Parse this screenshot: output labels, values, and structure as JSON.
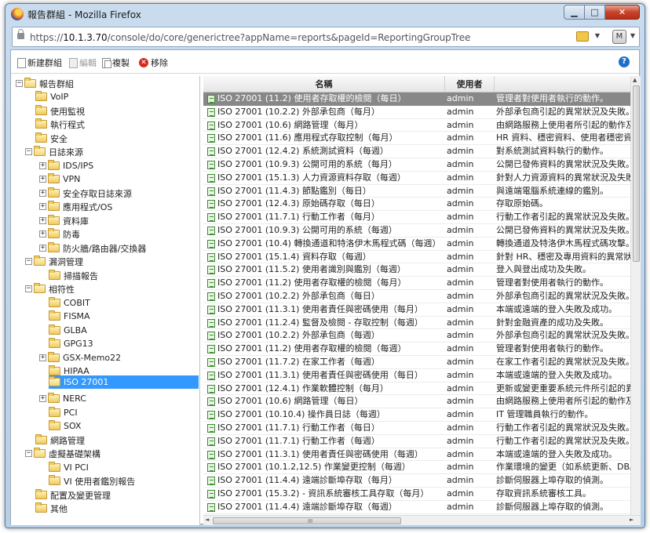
{
  "window": {
    "title": "報告群組 - Mozilla Firefox",
    "min_label": "▁",
    "max_label": "□",
    "close_label": "✕"
  },
  "address": {
    "url_prefix": "https://",
    "url_host": "10.1.3.70",
    "url_path": "/console/do/core/generictree?appName=reports&pageId=ReportingGroupTree"
  },
  "toolbar": {
    "new_label": "新建群組",
    "edit_label": "編輯",
    "copy_label": "複製",
    "remove_label": "移除",
    "help_label": "?"
  },
  "tree": {
    "root": "報告群組",
    "voip": "VoIP",
    "usage": "使用監視",
    "exec": "執行程式",
    "security": "安全",
    "logsrc": "日誌來源",
    "ids": "IDS/IPS",
    "vpn": "VPN",
    "seclog": "安全存取日誌來源",
    "app": "應用程式/OS",
    "db": "資料庫",
    "av": "防毒",
    "fw": "防火牆/路由器/交換器",
    "vuln": "漏洞管理",
    "scan": "掃描報告",
    "compliance": "相符性",
    "cobit": "COBIT",
    "fisma": "FISMA",
    "glba": "GLBA",
    "gpg13": "GPG13",
    "gsx": "GSX-Memo22",
    "hipaa": "HIPAA",
    "iso": "ISO 27001",
    "nerc": "NERC",
    "pci": "PCI",
    "sox": "SOX",
    "netmgmt": "網路管理",
    "virt": "虛擬基礎架構",
    "vipci": "VI PCI",
    "viuser": "VI 使用者鑑別報告",
    "config": "配置及變更管理",
    "other": "其他"
  },
  "grid": {
    "headers": {
      "name": "名稱",
      "owner": "使用者",
      "desc": ""
    },
    "scroll_grip": "III",
    "rows": [
      {
        "name": "ISO 27001 (11.2) 使用者存取權的檢閱（每日）",
        "owner": "admin",
        "desc": "管理者對使用者執行的動作。"
      },
      {
        "name": "ISO 27001 (10.2.2) 外部承包商（每月）",
        "owner": "admin",
        "desc": "外部承包商引起的異常狀況及失敗。"
      },
      {
        "name": "ISO 27001 (10.6) 網路管理（每月）",
        "owner": "admin",
        "desc": "由網路服務上使用者所引起的動作及"
      },
      {
        "name": "ISO 27001 (11.6) 應用程式存取控制（每月）",
        "owner": "admin",
        "desc": "HR 資料、穩密資料、使用者穩密資"
      },
      {
        "name": "ISO 27001 (12.4.2) 系統測試資料（每週）",
        "owner": "admin",
        "desc": "對系統測試資料執行的動作。"
      },
      {
        "name": "ISO 27001 (10.9.3) 公開可用的系統（每月）",
        "owner": "admin",
        "desc": "公開已發佈資料的異常狀況及失敗。"
      },
      {
        "name": "ISO 27001 (15.1.3) 人力資源資料存取（每週）",
        "owner": "admin",
        "desc": "針對人力資源資料的異常狀況及失敗"
      },
      {
        "name": "ISO 27001 (11.4.3) 節點鑑別（每日）",
        "owner": "admin",
        "desc": "與遠端電腦系統連線的鑑別。"
      },
      {
        "name": "ISO 27001 (12.4.3) 原始碼存取（每日）",
        "owner": "admin",
        "desc": "存取原始碼。"
      },
      {
        "name": "ISO 27001 (11.7.1) 行動工作者（每月）",
        "owner": "admin",
        "desc": "行動工作者引起的異常狀況及失敗。"
      },
      {
        "name": "ISO 27001 (10.9.3) 公開可用的系統（每週）",
        "owner": "admin",
        "desc": "公開已發佈資料的異常狀況及失敗。"
      },
      {
        "name": "ISO 27001 (10.4) 轉換通道和特洛伊木馬程式碼（每週）",
        "owner": "admin",
        "desc": "轉換通道及特洛伊木馬程式碼攻擊。"
      },
      {
        "name": "ISO 27001 (15.1.4) 資料存取（每週）",
        "owner": "admin",
        "desc": "針對 HR、穩密及專用資料的異常狀況"
      },
      {
        "name": "ISO 27001 (11.5.2) 使用者識別與鑑別（每週）",
        "owner": "admin",
        "desc": "登入與登出成功及失敗。"
      },
      {
        "name": "ISO 27001 (11.2) 使用者存取權的檢閱（每月）",
        "owner": "admin",
        "desc": "管理者對使用者執行的動作。"
      },
      {
        "name": "ISO 27001 (10.2.2) 外部承包商（每日）",
        "owner": "admin",
        "desc": "外部承包商引起的異常狀況及失敗。"
      },
      {
        "name": "ISO 27001 (11.3.1) 使用者責任與密碼使用（每月）",
        "owner": "admin",
        "desc": "本端或遠端的登入失敗及成功。"
      },
      {
        "name": "ISO 27001 (11.2.4) 監督及檢閱 - 存取控制（每週）",
        "owner": "admin",
        "desc": "針對金融資產的成功及失敗。"
      },
      {
        "name": "ISO 27001 (10.2.2) 外部承包商（每週）",
        "owner": "admin",
        "desc": "外部承包商引起的異常狀況及失敗。"
      },
      {
        "name": "ISO 27001 (11.2) 使用者存取權的檢閱（每週）",
        "owner": "admin",
        "desc": "管理者對使用者執行的動作。"
      },
      {
        "name": "ISO 27001 (11.7.2) 在家工作者（每週）",
        "owner": "admin",
        "desc": "在家工作者引起的異常狀況及失敗。"
      },
      {
        "name": "ISO 27001 (11.3.1) 使用者責任與密碼使用（每日）",
        "owner": "admin",
        "desc": "本端或遠端的登入失敗及成功。"
      },
      {
        "name": "ISO 27001 (12.4.1) 作業軟體控制（每月）",
        "owner": "admin",
        "desc": "更新或變更重要系統元件所引起的異"
      },
      {
        "name": "ISO 27001 (10.6) 網路管理（每日）",
        "owner": "admin",
        "desc": "由網路服務上使用者所引起的動作及"
      },
      {
        "name": "ISO 27001 (10.10.4) 操作員日誌（每週）",
        "owner": "admin",
        "desc": "IT 管理職員執行的動作。"
      },
      {
        "name": "ISO 27001 (11.7.1) 行動工作者（每日）",
        "owner": "admin",
        "desc": "行動工作者引起的異常狀況及失敗。"
      },
      {
        "name": "ISO 27001 (11.7.1) 行動工作者（每週）",
        "owner": "admin",
        "desc": "行動工作者引起的異常狀況及失敗。"
      },
      {
        "name": "ISO 27001 (11.3.1) 使用者責任與密碼使用（每週）",
        "owner": "admin",
        "desc": "本端或遠端的登入失敗及成功。"
      },
      {
        "name": "ISO 27001 (10.1.2,12.5) 作業變更控制（每週）",
        "owner": "admin",
        "desc": "作業環境的變更（如系統更新、DBA"
      },
      {
        "name": "ISO 27001 (11.4.4) 遠端診斷埠存取（每月）",
        "owner": "admin",
        "desc": "診斷伺服器上埠存取的偵測。"
      },
      {
        "name": "ISO 27001 (15.3.2) - 資訊系統審核工具存取（每月）",
        "owner": "admin",
        "desc": "存取資訊系統審核工具。"
      },
      {
        "name": "ISO 27001 (11.4.4) 遠端診斷埠存取（每週）",
        "owner": "admin",
        "desc": "診斷伺服器上埠存取的偵測。"
      }
    ]
  }
}
